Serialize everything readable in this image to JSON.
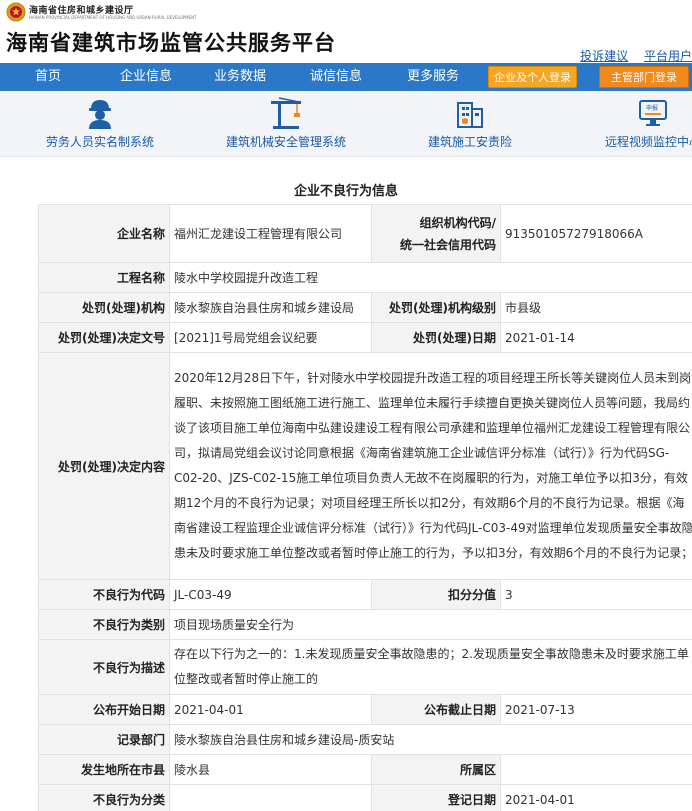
{
  "dept": {
    "name": "海南省住房和城乡建设厅",
    "english": "HAINAN PROVINCIAL DEPARTMENT OF HOUSING AND URBAN-RURAL DEVELOPMENT"
  },
  "header": {
    "title": "海南省建筑市场监管公共服务平台",
    "links": [
      "投诉建议",
      "平台用户"
    ]
  },
  "nav": {
    "items": [
      "首页",
      "企业信息",
      "业务数据",
      "诚信信息",
      "更多服务"
    ],
    "login_enterprise": "企业及个人登录",
    "login_admin": "主管部门登录"
  },
  "systems": [
    {
      "label": "劳务人员实名制系统",
      "icon": "worker-icon"
    },
    {
      "label": "建筑机械安全管理系统",
      "icon": "tower-crane-icon"
    },
    {
      "label": "建筑施工安责险",
      "icon": "building-insurance-icon"
    },
    {
      "label": "远程视频监控中心",
      "icon": "monitor-icon"
    }
  ],
  "page_heading": "企业不良行为信息",
  "record": {
    "company_name_label": "企业名称",
    "company_name": "福州汇龙建设工程管理有限公司",
    "org_code_label_1": "组织机构代码/",
    "org_code_label_2": "统一社会信用代码",
    "org_code": "91350105727918066A",
    "project_label": "工程名称",
    "project": "陵水中学校园提升改造工程",
    "authority_label": "处罚(处理)机构",
    "authority": "陵水黎族自治县住房和城乡建设局",
    "authority_level_label": "处罚(处理)机构级别",
    "authority_level": "市县级",
    "doc_no_label": "处罚(处理)决定文号",
    "doc_no": "[2021]1号局党组会议纪要",
    "date_label": "处罚(处理)日期",
    "date": "2021-01-14",
    "content_label": "处罚(处理)决定内容",
    "content": "2020年12月28日下午，针对陵水中学校园提升改造工程的项目经理王所长等关键岗位人员未到岗履职、未按照施工图纸施工进行施工、监理单位未履行手续擅自更换关键岗位人员等问题，我局约谈了该项目施工单位海南中弘建设建设工程有限公司承建和监理单位福州汇龙建设工程管理有限公司，拟请局党组会议讨论同意根据《海南省建筑施工企业诚信评分标准（试行）》行为代码SG-C02-20、JZS-C02-15施工单位项目负责人无故不在岗履职的行为，对施工单位予以扣3分，有效期12个月的不良行为记录；对项目经理王所长以扣2分，有效期6个月的不良行为记录。根据《海南省建设工程监理企业诚信评分标准（试行）》行为代码JL-C03-49对监理单位发现质量安全事故隐患未及时要求施工单位整改或者暂时停止施工的行为，予以扣3分，有效期6个月的不良行为记录；",
    "behavior_code_label": "不良行为代码",
    "behavior_code": "JL-C03-49",
    "deduction_label": "扣分分值",
    "deduction": "3",
    "category_label": "不良行为类别",
    "category": "项目现场质量安全行为",
    "description_label": "不良行为描述",
    "description": "存在以下行为之一的：1.未发现质量安全事故隐患的；2.发现质量安全事故隐患未及时要求施工单位整改或者暂时停止施工的",
    "publish_start_label": "公布开始日期",
    "publish_start": "2021-04-01",
    "publish_end_label": "公布截止日期",
    "publish_end": "2021-07-13",
    "record_dept_label": "记录部门",
    "record_dept": "陵水黎族自治县住房和城乡建设局-质安站",
    "city_label": "发生地所在市县",
    "city": "陵水县",
    "district_label": "所属区",
    "district": "",
    "behavior_class_label": "不良行为分类",
    "behavior_class": "",
    "register_date_label": "登记日期",
    "register_date": "2021-04-01"
  },
  "colors": {
    "nav_bg": "#2a78c7",
    "login_enterprise_bg": "#f5a623",
    "login_admin_bg": "#f08a1c",
    "link": "#1a5aa6",
    "label_bg": "#f3f3f3"
  }
}
